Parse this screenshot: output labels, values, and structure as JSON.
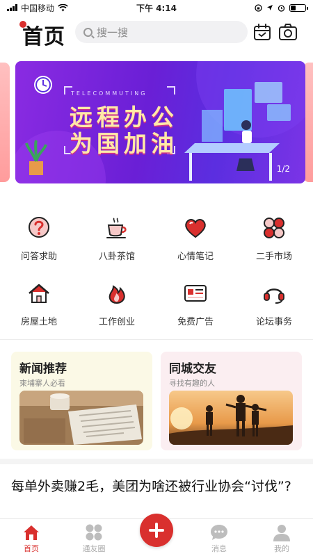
{
  "status_bar": {
    "carrier": "中国移动",
    "time": "下午 4:14",
    "battery_level": 0.35
  },
  "header": {
    "title": "首页",
    "search_placeholder": "搜一搜",
    "calendar_icon": "calendar-icon",
    "camera_icon": "camera-icon"
  },
  "banner": {
    "subtitle": "TELECOMMUTING",
    "headline_line1": "远程办公",
    "headline_line2": "为国加油",
    "page_indicator": "1/2"
  },
  "categories": [
    {
      "label": "问答求助",
      "icon": "question-icon"
    },
    {
      "label": "八卦茶馆",
      "icon": "teacup-icon"
    },
    {
      "label": "心情笔记",
      "icon": "heart-icon"
    },
    {
      "label": "二手市场",
      "icon": "clover-icon"
    },
    {
      "label": "房屋土地",
      "icon": "house-icon"
    },
    {
      "label": "工作创业",
      "icon": "flame-icon"
    },
    {
      "label": "免费广告",
      "icon": "ad-card-icon"
    },
    {
      "label": "论坛事务",
      "icon": "headset-icon"
    }
  ],
  "cards": {
    "news": {
      "title": "新闻推荐",
      "subtitle": "柬埔寨人必看"
    },
    "friends": {
      "title": "同城交友",
      "subtitle": "寻找有趣的人"
    }
  },
  "article": {
    "title": "每单外卖赚2毛，美团为啥还被行业协会“讨伐”?"
  },
  "tabbar": {
    "items": [
      {
        "label": "首页",
        "icon": "home-icon",
        "active": true
      },
      {
        "label": "通友圈",
        "icon": "grid-icon",
        "active": false
      },
      {
        "label": "",
        "icon": "plus-icon",
        "active": false
      },
      {
        "label": "消息",
        "icon": "message-icon",
        "active": false
      },
      {
        "label": "我的",
        "icon": "profile-icon",
        "active": false
      }
    ]
  },
  "colors": {
    "accent": "#d9302e",
    "banner_purple": "#6a1fd6",
    "news_card_bg": "#fbf9e6",
    "friends_card_bg": "#fbeef1"
  }
}
